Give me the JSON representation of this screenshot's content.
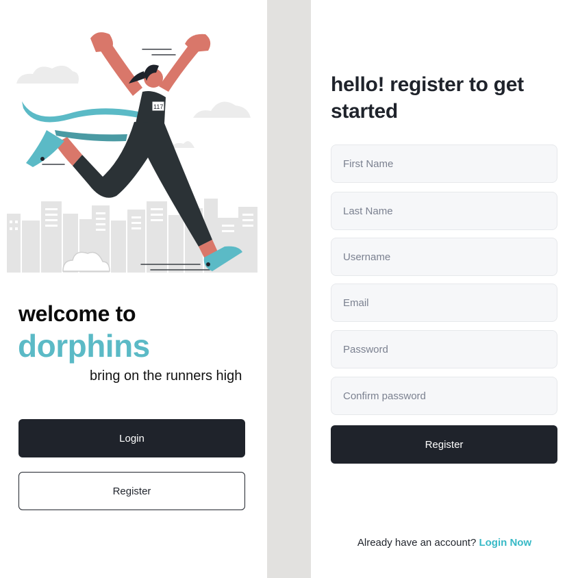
{
  "welcome": {
    "line1": "welcome to",
    "brand": "dorphins",
    "tagline": "bring on the runners high",
    "login_label": "Login",
    "register_label": "Register"
  },
  "hero": {
    "bib_number": "117"
  },
  "form": {
    "title": "hello! register to get started",
    "fields": [
      {
        "placeholder": "First Name",
        "value": ""
      },
      {
        "placeholder": "Last Name",
        "value": ""
      },
      {
        "placeholder": "Username",
        "value": ""
      },
      {
        "placeholder": "Email",
        "value": ""
      },
      {
        "placeholder": "Password",
        "value": ""
      },
      {
        "placeholder": "Confirm password",
        "value": ""
      }
    ],
    "submit_label": "Register",
    "footer_text": "Already have an account? ",
    "footer_link": "Login Now"
  },
  "colors": {
    "brand_teal": "#5bbac6",
    "link_teal": "#37b9c6",
    "dark_button": "#1f232b",
    "input_bg": "#f6f7f9",
    "divider": "#e2e1df"
  }
}
